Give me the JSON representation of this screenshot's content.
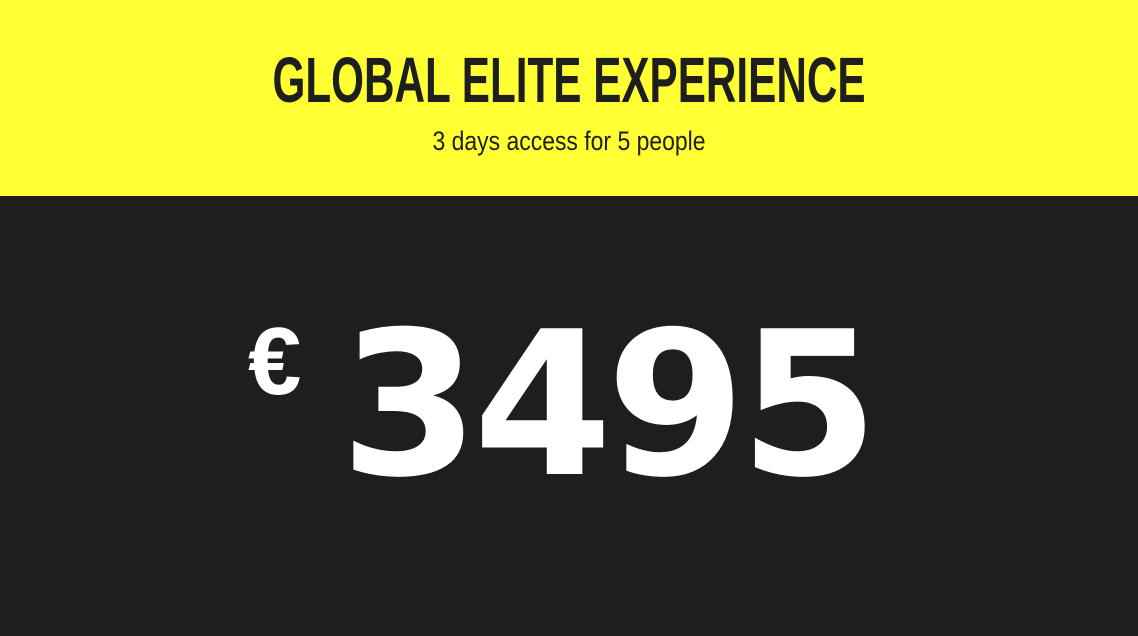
{
  "offer": {
    "title": "GLOBAL ELITE EXPERIENCE",
    "subtitle": "3 days access for 5 people"
  },
  "price": {
    "currency_symbol": "€",
    "amount": "3495"
  },
  "colors": {
    "header_background": "#ffff33",
    "panel_background": "#1e1e1e",
    "title_text": "#1e1e1e",
    "price_text": "#ffffff"
  }
}
